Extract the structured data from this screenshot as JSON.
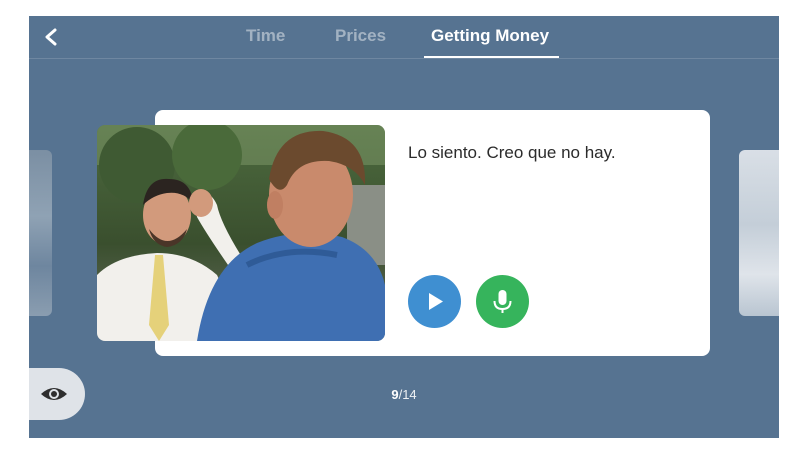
{
  "header": {
    "tabs": [
      {
        "label": "Time",
        "active": false
      },
      {
        "label": "Prices",
        "active": false
      },
      {
        "label": "Getting Money",
        "active": true
      }
    ]
  },
  "card": {
    "phrase": "Lo siento. Creo que no hay.",
    "play_icon": "play-icon",
    "mic_icon": "microphone-icon",
    "video_icon": "video-thumbnail"
  },
  "pager": {
    "current": "9",
    "separator": "/",
    "total": "14"
  },
  "colors": {
    "background": "#567391",
    "play_button": "#3f8fd1",
    "mic_button": "#36b45c",
    "card": "#ffffff"
  }
}
